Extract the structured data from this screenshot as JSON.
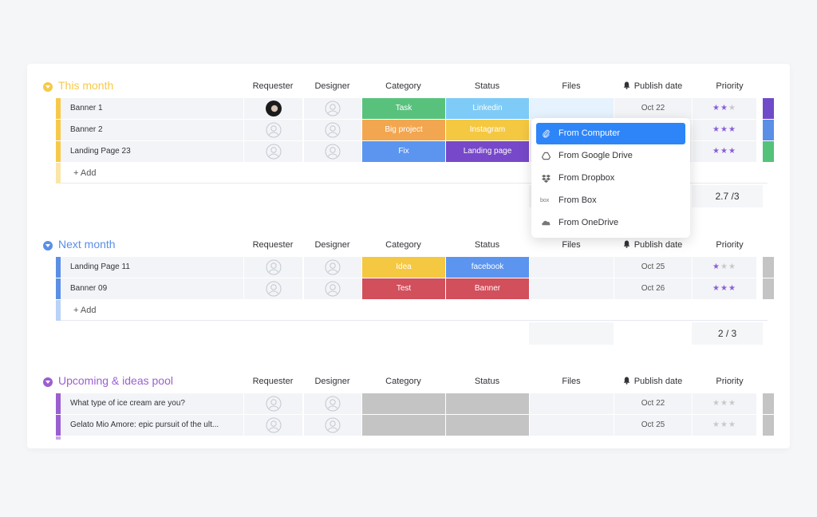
{
  "columns": {
    "requester": "Requester",
    "designer": "Designer",
    "category": "Category",
    "status": "Status",
    "files": "Files",
    "publish_date": "Publish date",
    "priority": "Priority"
  },
  "add_label": "+ Add",
  "colors": {
    "this_month": "#f7c94a",
    "next_month": "#5b8fe6",
    "upcoming": "#9b5fd0",
    "star_on": "#8b5fd6",
    "star_off": "#c9c9c9",
    "dropdown_active": "#2e85f8"
  },
  "groups": [
    {
      "title": "This month",
      "rows": [
        {
          "name": "Banner 1",
          "requester": "photo",
          "category": "Task",
          "category_color": "#58c27d",
          "status": "Linkedin",
          "status_color": "#7ecbf7",
          "date": "Oct 22",
          "priority": 2,
          "strip_color": "#6f4bc9"
        },
        {
          "name": "Banner 2",
          "requester": "empty",
          "category": "Big project",
          "category_color": "#f2a650",
          "status": "Instagram",
          "status_color": "#f5c842",
          "date": "",
          "priority": 3,
          "strip_color": "#5b8fe6"
        },
        {
          "name": "Landing Page 23",
          "requester": "empty",
          "category": "Fix",
          "category_color": "#5b95f0",
          "status": "Landing page",
          "status_color": "#7748c9",
          "date": "",
          "priority": 3,
          "strip_color": "#55c27a"
        }
      ],
      "summary": "2.7 /3"
    },
    {
      "title": "Next month",
      "rows": [
        {
          "name": "Landing Page 11",
          "requester": "empty",
          "category": "Idea",
          "category_color": "#f5c842",
          "status": "facebook",
          "status_color": "#5b95f0",
          "date": "Oct 25",
          "priority": 1,
          "strip_color": "#c4c4c4"
        },
        {
          "name": "Banner 09",
          "requester": "empty",
          "category": "Test",
          "category_color": "#d24f5c",
          "status": "Banner",
          "status_color": "#d24f5c",
          "date": "Oct 26",
          "priority": 3,
          "strip_color": "#c4c4c4"
        }
      ],
      "summary": "2 / 3"
    },
    {
      "title": "Upcoming & ideas pool",
      "rows": [
        {
          "name": "What type of ice cream are you?",
          "requester": "empty",
          "category": "",
          "category_color": "#c4c4c4",
          "status": "",
          "status_color": "#c4c4c4",
          "date": "Oct 22",
          "priority": 0,
          "strip_color": "#c4c4c4"
        },
        {
          "name": "Gelato Mio Amore: epic pursuit of the ult...",
          "requester": "empty",
          "category": "",
          "category_color": "#c4c4c4",
          "status": "",
          "status_color": "#c4c4c4",
          "date": "Oct 25",
          "priority": 0,
          "strip_color": "#c4c4c4"
        }
      ]
    }
  ],
  "files_dropdown": {
    "items": [
      {
        "label": "From Computer",
        "icon": "paperclip-icon",
        "active": true
      },
      {
        "label": "From Google Drive",
        "icon": "google-drive-icon",
        "active": false
      },
      {
        "label": "From Dropbox",
        "icon": "dropbox-icon",
        "active": false
      },
      {
        "label": "From Box",
        "icon": "box-icon",
        "active": false
      },
      {
        "label": "From OneDrive",
        "icon": "onedrive-icon",
        "active": false
      }
    ]
  }
}
